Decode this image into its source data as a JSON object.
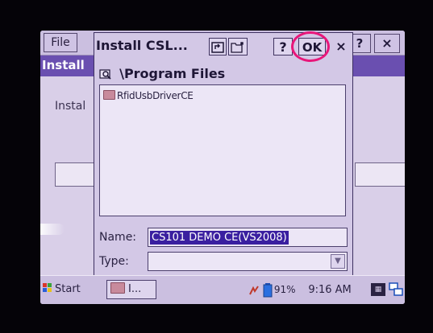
{
  "background_window": {
    "file_menu_label": "File",
    "help_button_label": "?",
    "close_button_label": "×",
    "title": "Install",
    "body_label": "Instal"
  },
  "dialog": {
    "title": "Install CSL...",
    "help_button_label": "?",
    "ok_button_label": "OK",
    "close_button_label": "×",
    "current_path": "\\Program Files",
    "files": [
      {
        "name": "RfidUsbDriverCE",
        "type": "folder"
      }
    ],
    "name_label": "Name:",
    "name_value": "CS101 DEMO CE(VS2008)",
    "type_label": "Type:",
    "type_value": ""
  },
  "taskbar": {
    "start_label": "Start",
    "task_label": "I...",
    "battery_percent": "91%",
    "clock": "9:16 AM"
  },
  "colors": {
    "highlight_circle": "#e8177a",
    "title_bar": "#6a4fb0",
    "selection": "#3a1fa0"
  }
}
